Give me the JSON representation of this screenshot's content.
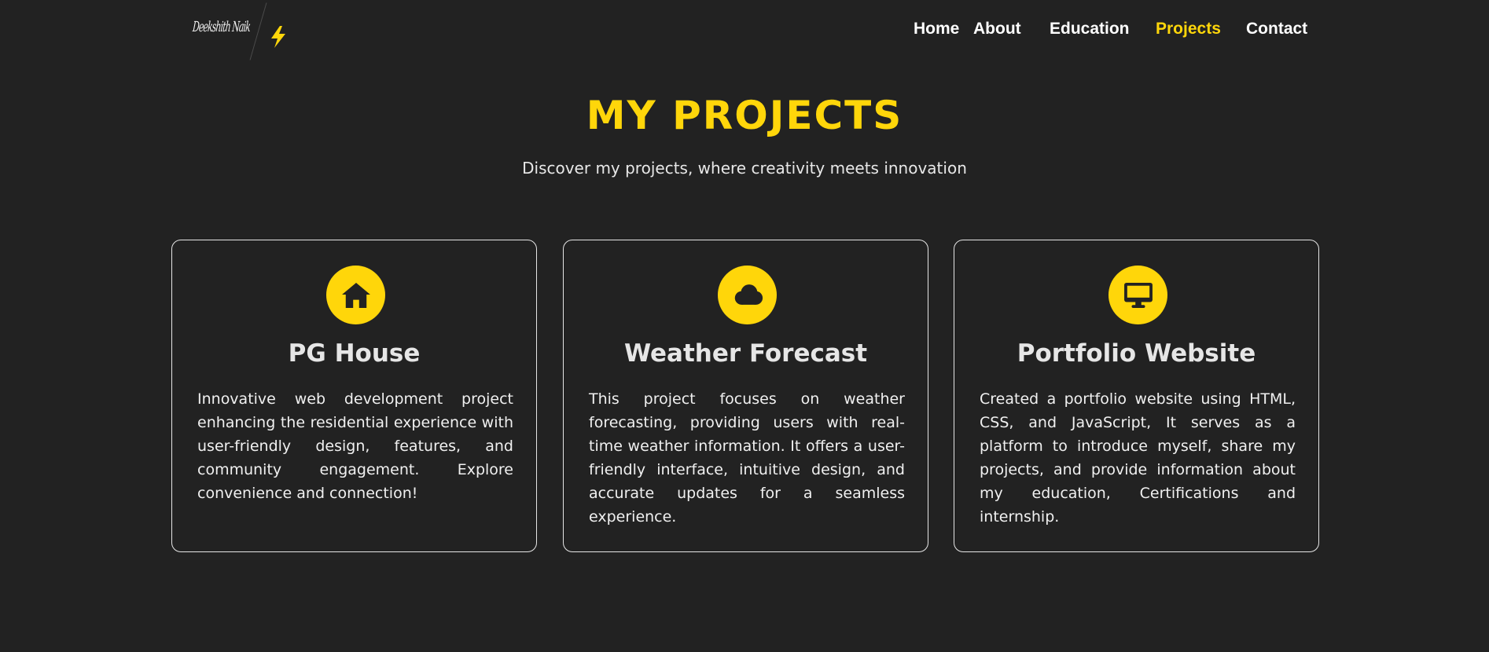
{
  "brand": {
    "signature": "Deekshith Naik",
    "bolt_icon": "lightning-bolt-icon",
    "bolt_color": "#ffd60a"
  },
  "nav": {
    "items": [
      {
        "id": "home",
        "label": "Home",
        "active": false
      },
      {
        "id": "about",
        "label": "About",
        "active": false
      },
      {
        "id": "education",
        "label": "Education",
        "active": false
      },
      {
        "id": "projects",
        "label": "Projects",
        "active": true
      },
      {
        "id": "contact",
        "label": "Contact",
        "active": false
      }
    ]
  },
  "hero": {
    "title": "MY PROJECTS",
    "subtitle": "Discover my projects, where creativity meets innovation"
  },
  "projects": [
    {
      "icon": "house-icon",
      "title": "PG House",
      "description": "Innovative web development project enhancing the residential experience with user-friendly design, features, and community engagement. Explore convenience and connection!"
    },
    {
      "icon": "cloud-icon",
      "title": "Weather Forecast",
      "description": "This project focuses on weather forecasting, providing users with real-time weather information. It offers a user-friendly interface, intuitive design, and accurate updates for a seamless experience."
    },
    {
      "icon": "desktop-monitor-icon",
      "title": "Portfolio Website",
      "description": "Created a portfolio website using HTML, CSS, and JavaScript, It serves as a platform to introduce myself, share my projects, and provide information about my education, Certifications and internship."
    }
  ],
  "colors": {
    "background": "#222222",
    "accent": "#ffd60a",
    "text": "#f2f2f2",
    "card_border": "#e6e6e6",
    "icon_glyph": "#222222"
  }
}
